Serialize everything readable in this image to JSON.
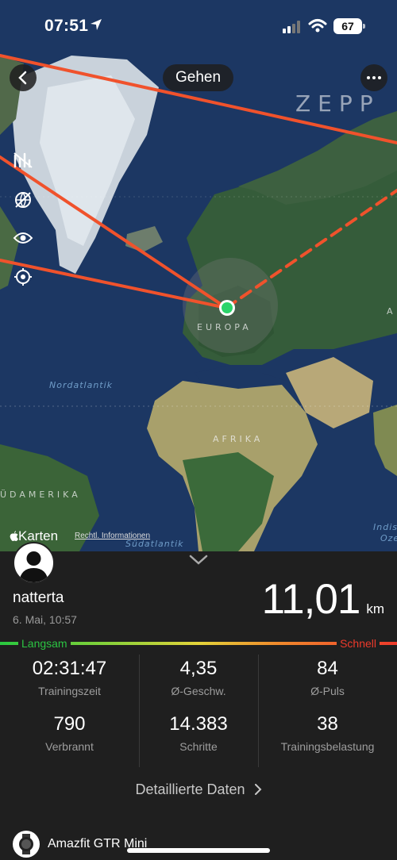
{
  "status_bar": {
    "time": "07:51",
    "battery": "67"
  },
  "header": {
    "activity": "Gehen",
    "brand": "ZEPP"
  },
  "map": {
    "labels": {
      "europe": "EUROPA",
      "africa": "AFRIKA",
      "south_america": "ÜDAMERIKA",
      "asia_partial": "A"
    },
    "seas": {
      "north_atlantic": "Nordatlantik",
      "south_atlantic": "Südatlantik",
      "indian_ocean_1": "Indis",
      "indian_ocean_2": "Oze"
    },
    "attribution": "Karten",
    "legal": "Rechtl. Informationen",
    "tools": [
      "pace-lines-icon",
      "hide-map-icon",
      "eye-icon",
      "locate-icon"
    ]
  },
  "workout": {
    "user": "natterta",
    "date": "6. Mai, 10:57",
    "distance": "11,01",
    "distance_unit": "km",
    "pace_slow": "Langsam",
    "pace_fast": "Schnell"
  },
  "stats": [
    {
      "value": "02:31:47",
      "label": "Trainingszeit"
    },
    {
      "value": "4,35",
      "label": "Ø-Geschw."
    },
    {
      "value": "84",
      "label": "Ø-Puls"
    },
    {
      "value": "790",
      "label": "Verbrannt"
    },
    {
      "value": "14.383",
      "label": "Schritte"
    },
    {
      "value": "38",
      "label": "Trainingsbelastung"
    }
  ],
  "detail_link": "Detaillierte Daten",
  "device": "Amazfit GTR Mini",
  "colors": {
    "route": "#f0522c",
    "slow": "#2bc442",
    "fast": "#ee3a2b"
  }
}
